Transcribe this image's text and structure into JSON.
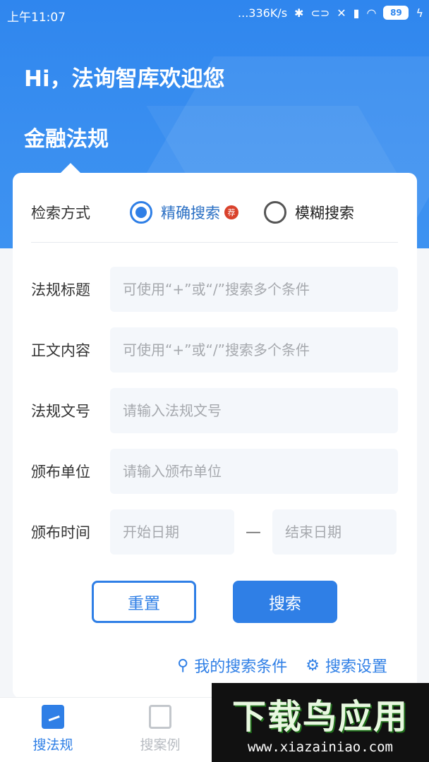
{
  "statusbar": {
    "time": "上午11:07",
    "net_speed": "...336K/s",
    "battery": "89"
  },
  "header": {
    "greeting": "Hi，法询智库欢迎您",
    "section": "金融法规"
  },
  "form": {
    "mode_label": "检索方式",
    "mode_options": [
      {
        "label": "精确搜索",
        "selected": true,
        "badge": "荐"
      },
      {
        "label": "模糊搜索",
        "selected": false
      }
    ],
    "fields": {
      "title": {
        "label": "法规标题",
        "placeholder": "可使用“+”或“/”搜索多个条件"
      },
      "content": {
        "label": "正文内容",
        "placeholder": "可使用“+”或“/”搜索多个条件"
      },
      "doc_number": {
        "label": "法规文号",
        "placeholder": "请输入法规文号"
      },
      "issuer": {
        "label": "颁布单位",
        "placeholder": "请输入颁布单位"
      },
      "date": {
        "label": "颁布时间",
        "start_placeholder": "开始日期",
        "separator": "—",
        "end_placeholder": "结束日期"
      }
    },
    "reset_label": "重置",
    "search_label": "搜索"
  },
  "links": {
    "my_conditions": "我的搜索条件",
    "settings": "搜索设置"
  },
  "tabbar": {
    "items": [
      {
        "label": "搜法规",
        "active": true
      },
      {
        "label": "搜案例",
        "active": false
      }
    ]
  },
  "watermark": {
    "title": "下载鸟应用",
    "url": "www.xiazainiao.com"
  },
  "colors": {
    "accent": "#2f7fe6",
    "header_bg": "#3a8ff0"
  }
}
